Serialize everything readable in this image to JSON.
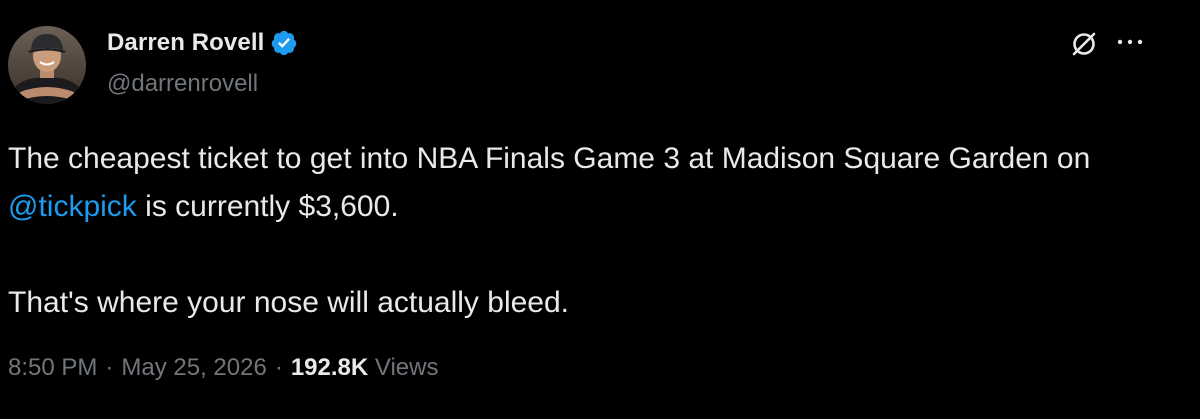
{
  "author": {
    "display_name": "Darren Rovell",
    "handle": "@darrenrovell",
    "verified": true
  },
  "icons": {
    "avatar": "profile-photo",
    "verified": "verified-badge-icon",
    "grok": "grok-icon",
    "more": "more-options-icon"
  },
  "tweet": {
    "line1_before": "The cheapest ticket to get into NBA Finals Game 3 at Madison Square Garden on ",
    "mention": "@tickpick",
    "line1_after": " is currently $3,600.",
    "paragraph2": "That's where your nose will actually bleed."
  },
  "meta": {
    "time": "8:50 PM",
    "separator": "·",
    "date": "May 25, 2026",
    "views_count": "192.8K",
    "views_label": "Views"
  },
  "colors": {
    "background": "#000000",
    "text": "#e7e9ea",
    "muted": "#71767b",
    "accent": "#1d9bf0"
  }
}
